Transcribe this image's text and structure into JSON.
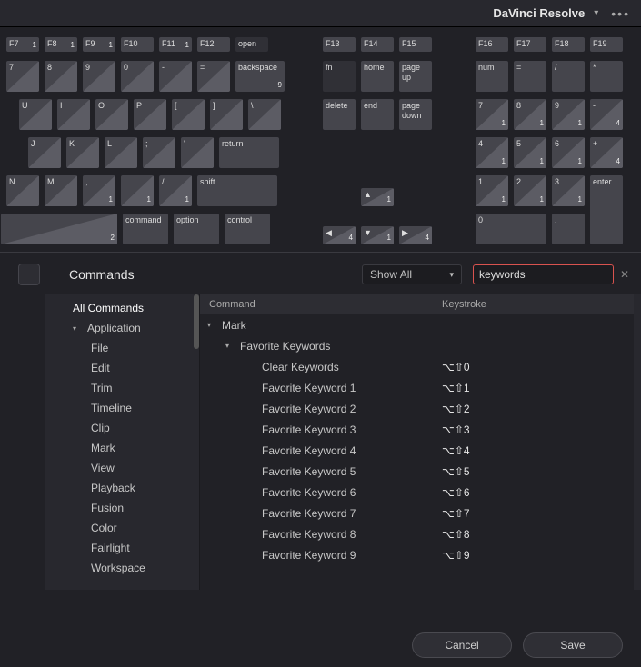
{
  "title": "DaVinci Resolve",
  "keyboard": {
    "row_f_left": [
      {
        "l": "F7",
        "c": "1"
      },
      {
        "l": "F8",
        "c": "1"
      },
      {
        "l": "F9",
        "c": "1"
      },
      {
        "l": "F10",
        "c": ""
      },
      {
        "l": "F11",
        "c": "1"
      },
      {
        "l": "F12",
        "c": ""
      },
      {
        "l": "open",
        "c": "",
        "dark": true
      }
    ],
    "row_f_mid": [
      {
        "l": "F13"
      },
      {
        "l": "F14"
      },
      {
        "l": "F15"
      }
    ],
    "row_f_right": [
      {
        "l": "F16"
      },
      {
        "l": "F17"
      },
      {
        "l": "F18"
      },
      {
        "l": "F19"
      }
    ],
    "row_num": [
      {
        "l": "7",
        "c": ""
      },
      {
        "l": "8",
        "c": ""
      },
      {
        "l": "9",
        "c": ""
      },
      {
        "l": "0",
        "c": ""
      },
      {
        "l": "-",
        "c": ""
      },
      {
        "l": "=",
        "c": ""
      },
      {
        "l": "backspace",
        "c": "9",
        "wide": 1
      }
    ],
    "row_mid1": [
      {
        "l": "fn",
        "dark": true
      },
      {
        "l": "home"
      },
      {
        "l": "page up"
      }
    ],
    "row_np1": [
      {
        "l": "num"
      },
      {
        "l": "="
      },
      {
        "l": "/"
      },
      {
        "l": "*"
      }
    ],
    "row_q": [
      {
        "l": "U",
        "c": ""
      },
      {
        "l": "I",
        "c": ""
      },
      {
        "l": "O",
        "c": ""
      },
      {
        "l": "P",
        "c": ""
      },
      {
        "l": "[",
        "c": ""
      },
      {
        "l": "]",
        "c": ""
      },
      {
        "l": "\\",
        "c": ""
      }
    ],
    "row_mid2": [
      {
        "l": "delete"
      },
      {
        "l": "end"
      },
      {
        "l": "page down"
      }
    ],
    "row_np2": [
      {
        "l": "7",
        "c": "1"
      },
      {
        "l": "8",
        "c": "1"
      },
      {
        "l": "9",
        "c": "1"
      },
      {
        "l": "-",
        "c": "4"
      }
    ],
    "row_a": [
      {
        "l": "J",
        "c": ""
      },
      {
        "l": "K",
        "c": ""
      },
      {
        "l": "L",
        "c": ""
      },
      {
        "l": ";",
        "c": ""
      },
      {
        "l": "'",
        "c": ""
      },
      {
        "l": "return",
        "c": "",
        "wide": 1
      }
    ],
    "row_np3": [
      {
        "l": "4",
        "c": "1"
      },
      {
        "l": "5",
        "c": "1"
      },
      {
        "l": "6",
        "c": "1"
      },
      {
        "l": "+",
        "c": "4"
      }
    ],
    "row_z": [
      {
        "l": "N",
        "c": ""
      },
      {
        "l": "M",
        "c": ""
      },
      {
        "l": ",",
        "c": "1"
      },
      {
        "l": ".",
        "c": "1"
      },
      {
        "l": "/",
        "c": "1"
      },
      {
        "l": "shift",
        "c": "",
        "wide": 1
      }
    ],
    "arrow_up": {
      "c": "1"
    },
    "row_np4": [
      {
        "l": "1",
        "c": "1"
      },
      {
        "l": "2",
        "c": "1"
      },
      {
        "l": "3",
        "c": "1"
      }
    ],
    "np_enter": {
      "l": "enter"
    },
    "row_bottom": [
      {
        "l": "",
        "c": "2",
        "wedge": 1,
        "wide": 2
      },
      {
        "l": "command",
        "c": ""
      },
      {
        "l": "option",
        "c": ""
      },
      {
        "l": "control",
        "c": ""
      }
    ],
    "arrows": [
      {
        "c": "4"
      },
      {
        "c": "1"
      },
      {
        "c": "4"
      }
    ],
    "row_np5": [
      {
        "l": "0",
        "c": "",
        "wide": 1
      },
      {
        "l": ".",
        "c": ""
      }
    ]
  },
  "commands_title": "Commands",
  "filter_label": "Show All",
  "search_value": "keywords",
  "tree": {
    "all": "All Commands",
    "app": "Application",
    "items": [
      "File",
      "Edit",
      "Trim",
      "Timeline",
      "Clip",
      "Mark",
      "View",
      "Playback",
      "Fusion",
      "Color",
      "Fairlight",
      "Workspace"
    ]
  },
  "table": {
    "h1": "Command",
    "h2": "Keystroke",
    "group1": "Mark",
    "group2": "Favorite Keywords",
    "rows": [
      {
        "cmd": "Clear Keywords",
        "key": "⌥⇧0"
      },
      {
        "cmd": "Favorite Keyword 1",
        "key": "⌥⇧1"
      },
      {
        "cmd": "Favorite Keyword 2",
        "key": "⌥⇧2"
      },
      {
        "cmd": "Favorite Keyword 3",
        "key": "⌥⇧3"
      },
      {
        "cmd": "Favorite Keyword 4",
        "key": "⌥⇧4"
      },
      {
        "cmd": "Favorite Keyword 5",
        "key": "⌥⇧5"
      },
      {
        "cmd": "Favorite Keyword 6",
        "key": "⌥⇧6"
      },
      {
        "cmd": "Favorite Keyword 7",
        "key": "⌥⇧7"
      },
      {
        "cmd": "Favorite Keyword 8",
        "key": "⌥⇧8"
      },
      {
        "cmd": "Favorite Keyword 9",
        "key": "⌥⇧9"
      }
    ]
  },
  "buttons": {
    "cancel": "Cancel",
    "save": "Save"
  }
}
